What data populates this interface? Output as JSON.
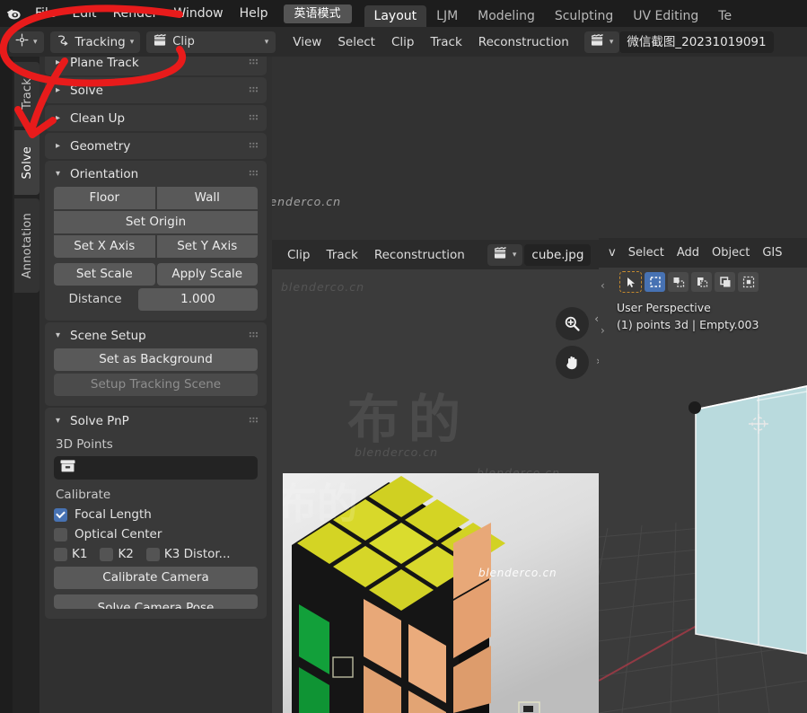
{
  "app": {
    "logo_icon": "blender-logo-icon"
  },
  "topbar": {
    "menus": [
      "File",
      "Edit",
      "Render",
      "Window",
      "Help"
    ],
    "language_button": "英语模式",
    "workspace_tabs": [
      {
        "label": "Layout",
        "active": true
      },
      {
        "label": "LJM",
        "active": false
      },
      {
        "label": "Modeling",
        "active": false
      },
      {
        "label": "Sculpting",
        "active": false
      },
      {
        "label": "UV Editing",
        "active": false
      },
      {
        "label": "Te",
        "active": false
      }
    ]
  },
  "clip_editor_header": {
    "editor_type_icon": "movie-clip-editor-icon",
    "mode_value": "Tracking",
    "mode_icon": "tracking-motion-icon",
    "view_layer_icon": "clip-datablock-icon",
    "clip_value": "Clip",
    "menus": [
      "View",
      "Select",
      "Clip",
      "Track",
      "Reconstruction"
    ],
    "file_browse_icon": "clip-browse-icon",
    "file_name": "微信截图_20231019091"
  },
  "vertical_tabs": [
    {
      "label": "Track",
      "active": false
    },
    {
      "label": "Solve",
      "active": true
    },
    {
      "label": "Annotation",
      "active": false
    }
  ],
  "properties": {
    "panels": [
      {
        "title": "Plane Track",
        "expanded": false,
        "cut_off": true
      },
      {
        "title": "Solve",
        "expanded": false
      },
      {
        "title": "Clean Up",
        "expanded": false
      },
      {
        "title": "Geometry",
        "expanded": false
      }
    ],
    "orientation": {
      "title": "Orientation",
      "expanded": true,
      "floor_button": "Floor",
      "wall_button": "Wall",
      "set_origin_button": "Set Origin",
      "set_x_axis_button": "Set X Axis",
      "set_y_axis_button": "Set Y Axis",
      "set_scale_button": "Set Scale",
      "apply_scale_button": "Apply Scale",
      "distance_label": "Distance",
      "distance_value": "1.000"
    },
    "scene_setup": {
      "title": "Scene Setup",
      "expanded": true,
      "set_as_background_button": "Set as Background",
      "setup_tracking_scene_button": "Setup Tracking Scene",
      "setup_tracking_scene_disabled": true
    },
    "solve_pnp": {
      "title": "Solve PnP",
      "expanded": true,
      "points_label": "3D Points",
      "points_value": "",
      "points_icon": "collection-box-icon",
      "calibrate_label": "Calibrate",
      "checkboxes": [
        {
          "label": "Focal Length",
          "checked": true
        },
        {
          "label": "Optical Center",
          "checked": false
        }
      ],
      "distortion": [
        {
          "label": "K1",
          "checked": false
        },
        {
          "label": "K2",
          "checked": false
        },
        {
          "label": "K3 Distor...",
          "checked": false
        }
      ],
      "calibrate_camera_button": "Calibrate Camera",
      "solve_camera_pose_button": "Solve Camera Pose"
    }
  },
  "inner_clip_editor": {
    "menus": [
      "Clip",
      "Track",
      "Reconstruction"
    ],
    "browse_icon": "clip-browse-icon",
    "file_name": "cube.jpg",
    "zoom_tool_icon": "zoom-in-icon",
    "pan_tool_icon": "hand-pan-icon",
    "marker_count": 2
  },
  "viewport_3d": {
    "menus": [
      "v",
      "Select",
      "Add",
      "Object",
      "GIS"
    ],
    "mode_icons": [
      "tweak-select-icon",
      "box-select-icon",
      "circle-select-icon",
      "lasso-select-icon",
      "cursor-icon",
      "select-box-icon"
    ],
    "active_mode_index": 1,
    "perspective_text": "User Perspective",
    "collection_text": "(1) points 3d | Empty.003"
  },
  "watermarks": {
    "site": "blenderco.cn",
    "brand_cn": "布的"
  },
  "annotation": {
    "type": "red-circle-arrow",
    "color": "#e81b1b",
    "target_circle": "Tracking mode dropdown",
    "arrow_points_to": "Solve tab"
  },
  "colors": {
    "accent_blue": "#4772b3",
    "annotation_red": "#e81b1b",
    "panel_bg": "#303030",
    "header_bg": "#2b2b2b",
    "top_bg": "#1d1d1d",
    "button_bg": "#595959",
    "cube_yellow": "#d6d626",
    "cube_orange": "#e8a878",
    "cube_green": "#1ba03f",
    "viewport_cube": "#b9dadd"
  }
}
